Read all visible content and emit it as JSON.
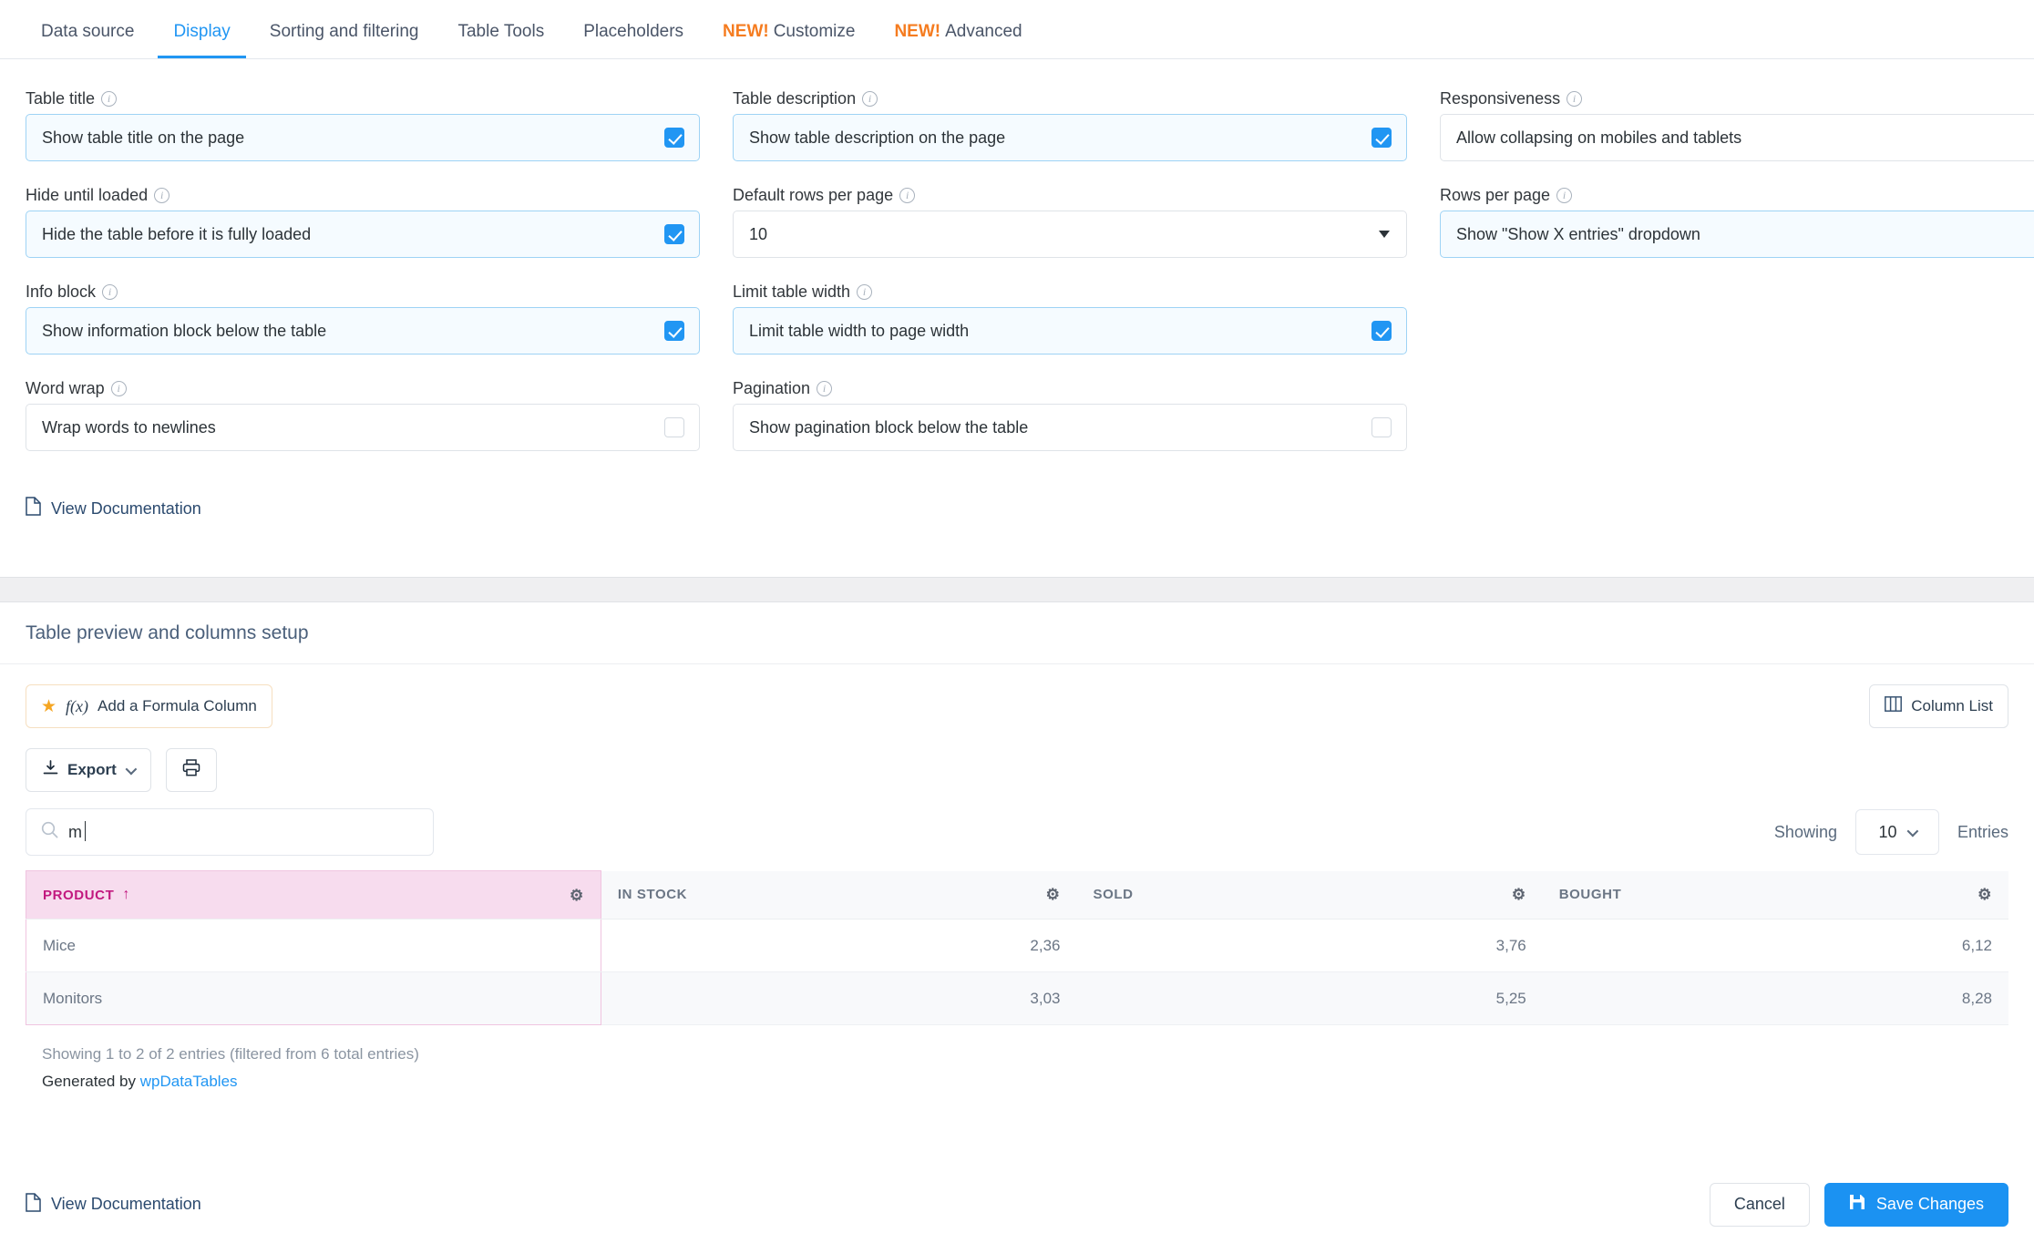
{
  "tabs": [
    {
      "label": "Data source",
      "new": "",
      "active": false
    },
    {
      "label": "Display",
      "new": "",
      "active": true
    },
    {
      "label": "Sorting and filtering",
      "new": "",
      "active": false
    },
    {
      "label": "Table Tools",
      "new": "",
      "active": false
    },
    {
      "label": "Placeholders",
      "new": "",
      "active": false
    },
    {
      "label": "Customize",
      "new": "NEW!",
      "active": false
    },
    {
      "label": "Advanced",
      "new": "NEW!",
      "active": false
    }
  ],
  "settings": {
    "fields": [
      {
        "label": "Table title",
        "value": "Show table title on the page",
        "type": "checkbox",
        "checked": true
      },
      {
        "label": "Table description",
        "value": "Show table description on the page",
        "type": "checkbox",
        "checked": true
      },
      {
        "label": "Responsiveness",
        "value": "Allow collapsing on mobiles and tablets",
        "type": "checkbox",
        "checked": false
      },
      {
        "label": "Hide until loaded",
        "value": "Hide the table before it is fully loaded",
        "type": "checkbox",
        "checked": true
      },
      {
        "label": "Default rows per page",
        "value": "10",
        "type": "select",
        "checked": false
      },
      {
        "label": "Rows per page",
        "value": "Show \"Show X entries\" dropdown",
        "type": "checkbox",
        "checked": true
      },
      {
        "label": "Info block",
        "value": "Show information block below the table",
        "type": "checkbox",
        "checked": true
      },
      {
        "label": "Limit table width",
        "value": "Limit table width to page width",
        "type": "checkbox",
        "checked": true
      },
      {
        "label": "",
        "value": "",
        "type": "empty",
        "checked": false
      },
      {
        "label": "Word wrap",
        "value": "Wrap words to newlines",
        "type": "checkbox",
        "checked": false
      },
      {
        "label": "Pagination",
        "value": "Show pagination block below the table",
        "type": "checkbox",
        "checked": false
      },
      {
        "label": "",
        "value": "",
        "type": "empty",
        "checked": false
      }
    ],
    "doc_link": "View Documentation"
  },
  "preview": {
    "title": "Table preview and columns setup",
    "formula_button": "Add a Formula Column",
    "fx_label": "f(x)",
    "column_list_button": "Column List",
    "export_button": "Export",
    "search_value": "m",
    "showing_label": "Showing",
    "entries_value": "10",
    "entries_label": "Entries",
    "columns": [
      {
        "label": "PRODUCT",
        "active": true,
        "sorted": true,
        "sort_arrow": "↑",
        "align": "left"
      },
      {
        "label": "IN STOCK",
        "active": false,
        "sorted": false,
        "sort_arrow": "",
        "align": "right"
      },
      {
        "label": "SOLD",
        "active": false,
        "sorted": false,
        "sort_arrow": "",
        "align": "right"
      },
      {
        "label": "BOUGHT",
        "active": false,
        "sorted": false,
        "sort_arrow": "",
        "align": "right"
      }
    ],
    "rows": [
      {
        "product": "Mice",
        "in_stock": "2,36",
        "sold": "3,76",
        "bought": "6,12"
      },
      {
        "product": "Monitors",
        "in_stock": "3,03",
        "sold": "5,25",
        "bought": "8,28"
      }
    ],
    "footer_info": "Showing 1 to 2 of 2 entries (filtered from 6 total entries)",
    "generated_prefix": "Generated by ",
    "generated_link": "wpDataTables",
    "doc_link": "View Documentation"
  },
  "actions": {
    "cancel": "Cancel",
    "save": "Save Changes"
  },
  "colors": {
    "accent": "#2196f3",
    "new_badge": "#f57c20",
    "active_column_bg": "#f7dcee",
    "active_column_text": "#c2187f",
    "save_button": "#1b92f2",
    "link": "#2196f3"
  }
}
